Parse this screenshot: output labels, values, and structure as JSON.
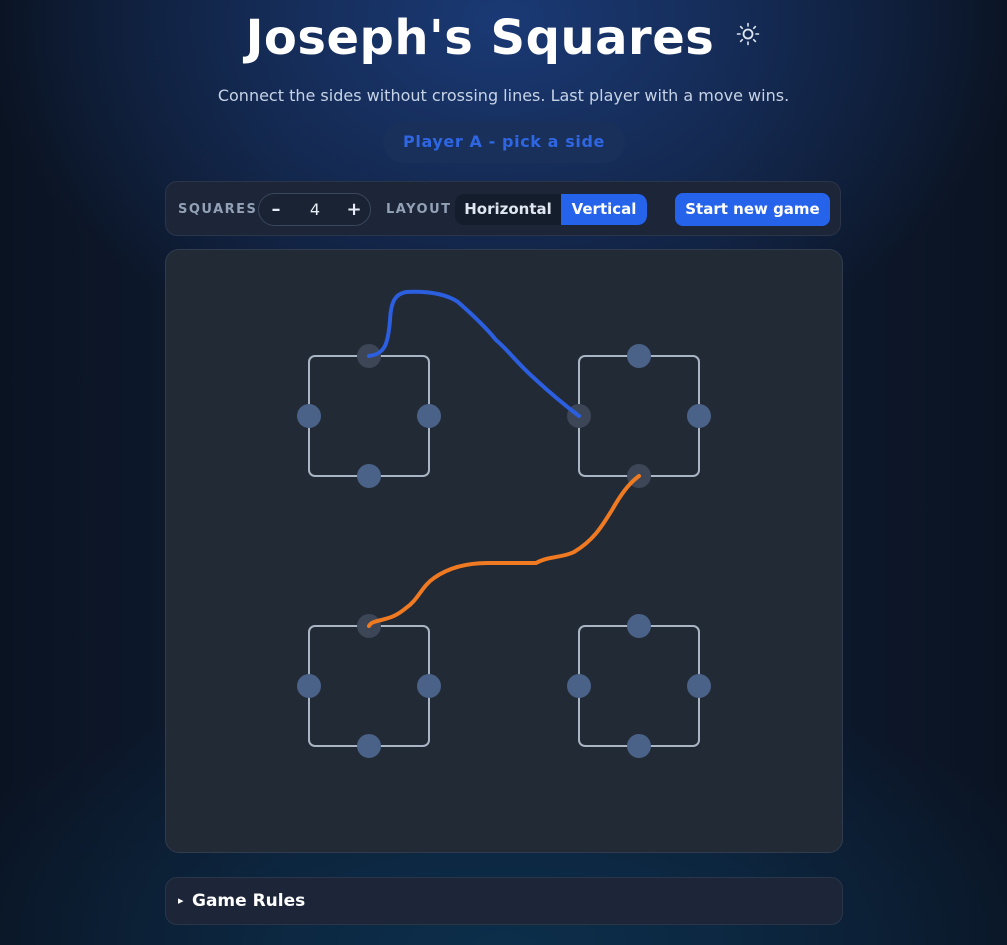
{
  "title": "Joseph's Squares",
  "theme_icon": "sun-icon",
  "subtitle": "Connect the sides without crossing lines. Last player with a move wins.",
  "status": "Player A - pick a side",
  "toolbar": {
    "squares_label": "SQUARES",
    "decrement": "–",
    "squares_value": "4",
    "increment": "+",
    "layout_label": "LAYOUT",
    "layout_options": [
      "Horizontal",
      "Vertical"
    ],
    "layout_selected": "Vertical",
    "new_game_label": "Start new game"
  },
  "board": {
    "squares": 4,
    "sides_per_square": 4,
    "connections": [
      {
        "player": "A",
        "from": {
          "square": 1,
          "side": "top"
        },
        "to": {
          "square": 2,
          "side": "left"
        }
      },
      {
        "player": "B",
        "from": {
          "square": 2,
          "side": "bottom"
        },
        "to": {
          "square": 3,
          "side": "top"
        }
      }
    ]
  },
  "colors": {
    "player_a": "#2b5fe0",
    "player_b": "#f07a22",
    "accent": "#2563eb",
    "square_outline": "#a9b4c4",
    "node": "#4a6288",
    "used_node": "#3c4656"
  },
  "rules": {
    "caret": "▸",
    "label": "Game Rules"
  }
}
